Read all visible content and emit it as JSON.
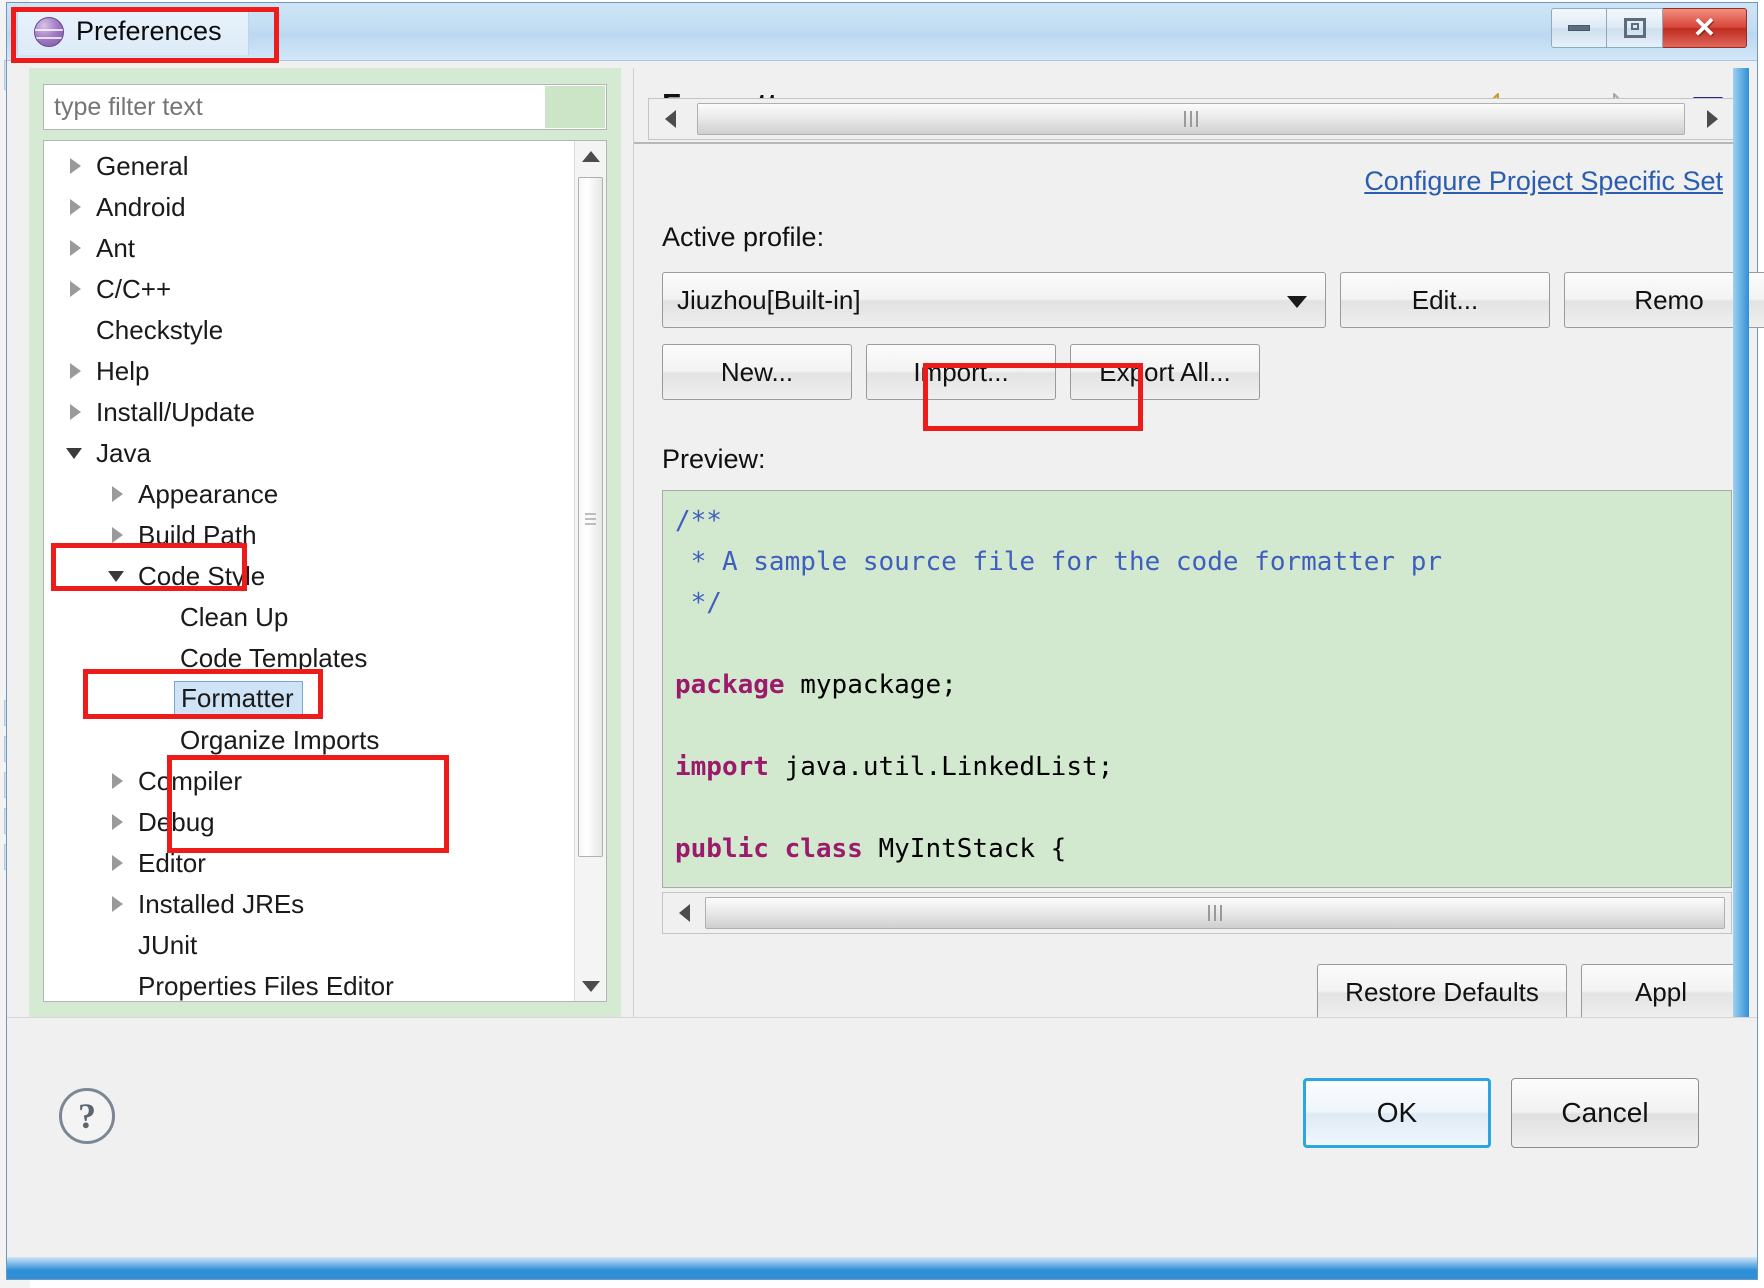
{
  "window": {
    "title": "Preferences",
    "icon": "eclipse-icon",
    "minimize_label": "Minimize",
    "maximize_label": "Maximize",
    "close_label": "Close"
  },
  "filter": {
    "placeholder": "type filter text",
    "value": ""
  },
  "tree": {
    "items": [
      {
        "label": "General",
        "level": 0,
        "state": "collapsed",
        "selected": false
      },
      {
        "label": "Android",
        "level": 0,
        "state": "collapsed",
        "selected": false
      },
      {
        "label": "Ant",
        "level": 0,
        "state": "collapsed",
        "selected": false
      },
      {
        "label": "C/C++",
        "level": 0,
        "state": "collapsed",
        "selected": false
      },
      {
        "label": "Checkstyle",
        "level": 0,
        "state": "leaf",
        "selected": false
      },
      {
        "label": "Help",
        "level": 0,
        "state": "collapsed",
        "selected": false
      },
      {
        "label": "Install/Update",
        "level": 0,
        "state": "collapsed",
        "selected": false
      },
      {
        "label": "Java",
        "level": 0,
        "state": "expanded",
        "selected": false
      },
      {
        "label": "Appearance",
        "level": 1,
        "state": "collapsed",
        "selected": false
      },
      {
        "label": "Build Path",
        "level": 1,
        "state": "collapsed",
        "selected": false
      },
      {
        "label": "Code Style",
        "level": 1,
        "state": "expanded",
        "selected": false
      },
      {
        "label": "Clean Up",
        "level": 2,
        "state": "leaf",
        "selected": false
      },
      {
        "label": "Code Templates",
        "level": 2,
        "state": "leaf",
        "selected": false
      },
      {
        "label": "Formatter",
        "level": 2,
        "state": "leaf",
        "selected": true
      },
      {
        "label": "Organize Imports",
        "level": 2,
        "state": "leaf",
        "selected": false
      },
      {
        "label": "Compiler",
        "level": 1,
        "state": "collapsed",
        "selected": false
      },
      {
        "label": "Debug",
        "level": 1,
        "state": "collapsed",
        "selected": false
      },
      {
        "label": "Editor",
        "level": 1,
        "state": "collapsed",
        "selected": false
      },
      {
        "label": "Installed JREs",
        "level": 1,
        "state": "collapsed",
        "selected": false
      },
      {
        "label": "JUnit",
        "level": 1,
        "state": "leaf",
        "selected": false
      },
      {
        "label": "Properties Files Editor",
        "level": 1,
        "state": "leaf",
        "selected": false
      }
    ]
  },
  "page": {
    "title": "Formatter",
    "configure_link": "Configure Project Specific Set",
    "active_profile_label": "Active profile:",
    "active_profile_value": "Jiuzhou[Built-in]",
    "buttons": {
      "edit": "Edit...",
      "remove": "Remo",
      "new": "New...",
      "import": "Import...",
      "export_all": "Export All...",
      "restore_defaults": "Restore Defaults",
      "apply": "Appl"
    },
    "preview_label": "Preview:",
    "preview_code": [
      {
        "segments": [
          {
            "text": "/**",
            "style": "comment"
          }
        ]
      },
      {
        "segments": [
          {
            "text": " * A sample source file for the code formatter pr",
            "style": "comment"
          }
        ]
      },
      {
        "segments": [
          {
            "text": " */",
            "style": "comment"
          }
        ]
      },
      {
        "segments": [
          {
            "text": "",
            "style": "plain"
          }
        ]
      },
      {
        "segments": [
          {
            "text": "package",
            "style": "keyword"
          },
          {
            "text": " mypackage;",
            "style": "plain"
          }
        ]
      },
      {
        "segments": [
          {
            "text": "",
            "style": "plain"
          }
        ]
      },
      {
        "segments": [
          {
            "text": "import",
            "style": "keyword"
          },
          {
            "text": " java.util.LinkedList;",
            "style": "plain"
          }
        ]
      },
      {
        "segments": [
          {
            "text": "",
            "style": "plain"
          }
        ]
      },
      {
        "segments": [
          {
            "text": "public class",
            "style": "keyword"
          },
          {
            "text": " MyIntStack {",
            "style": "plain"
          }
        ]
      }
    ]
  },
  "nav": {
    "back_icon": "back-arrow-icon",
    "back_menu_icon": "chevron-down-icon",
    "forward_icon": "forward-arrow-icon",
    "forward_menu_icon": "chevron-down-icon",
    "view_menu_icon": "chevron-down-icon"
  },
  "footer": {
    "help_glyph": "?",
    "ok": "OK",
    "cancel": "Cancel"
  },
  "colors": {
    "accent_blue": "#2f8fd6",
    "annotation_red": "#ee1b1b",
    "link_blue": "#2a5db0",
    "preview_bg": "#d2e8cf",
    "keyword": "#9b1a6b",
    "comment": "#3f5fbf",
    "selection": "#cfe3f7"
  }
}
